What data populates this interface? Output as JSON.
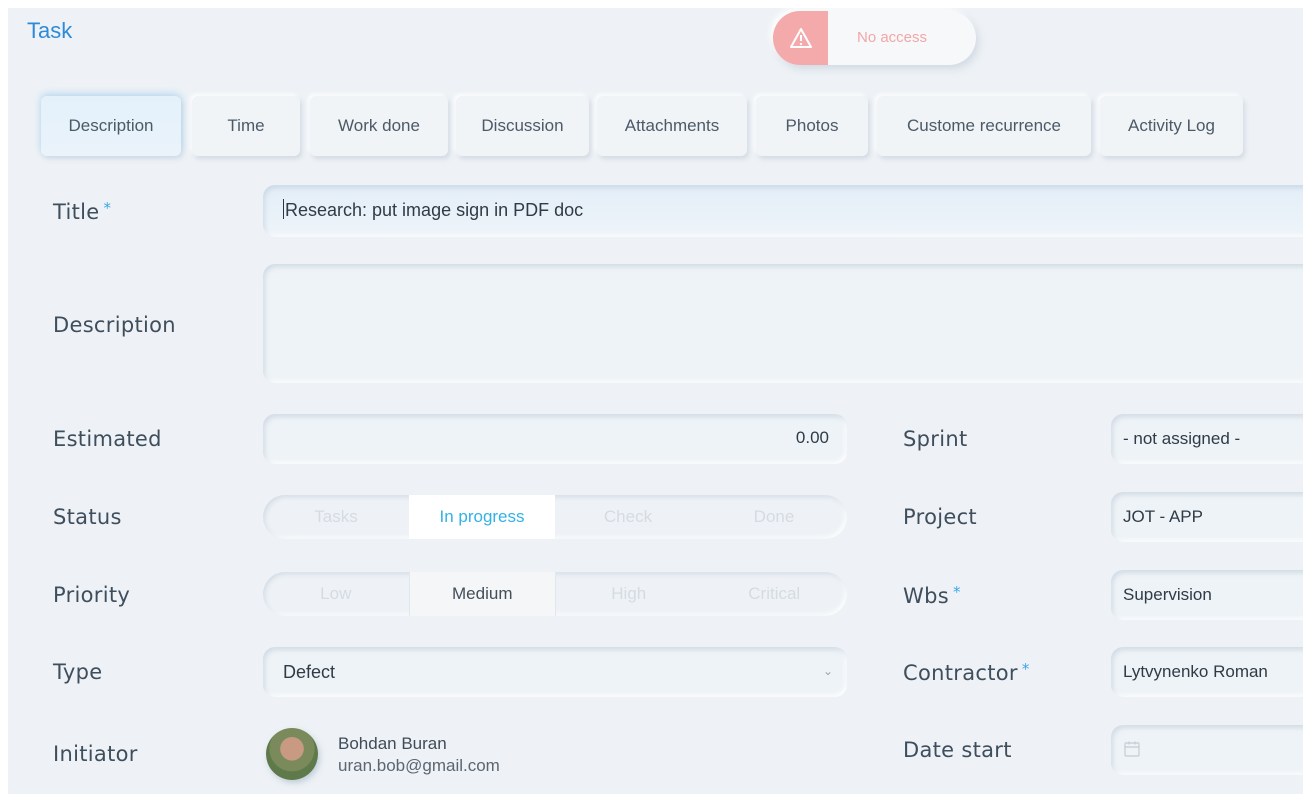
{
  "header": {
    "title": "Task"
  },
  "alert": {
    "text": "No access",
    "icon": "warning-icon"
  },
  "tabs": [
    {
      "label": "Description",
      "active": true
    },
    {
      "label": "Time"
    },
    {
      "label": "Work done"
    },
    {
      "label": "Discussion"
    },
    {
      "label": "Attachments"
    },
    {
      "label": "Photos"
    },
    {
      "label": "Custome recurrence"
    },
    {
      "label": "Activity Log"
    }
  ],
  "form": {
    "title": {
      "label": "Title",
      "required_mark": "*",
      "value": "Research: put image sign in PDF doc"
    },
    "description": {
      "label": "Description",
      "value": ""
    },
    "estimated": {
      "label": "Estimated",
      "value": "0.00"
    },
    "status": {
      "label": "Status",
      "options": [
        "Tasks",
        "In progress",
        "Check",
        "Done"
      ],
      "selected": "In progress"
    },
    "priority": {
      "label": "Priority",
      "options": [
        "Low",
        "Medium",
        "High",
        "Critical"
      ],
      "selected": "Medium"
    },
    "type": {
      "label": "Type",
      "value": "Defect"
    },
    "initiator": {
      "label": "Initiator",
      "name": "Bohdan Buran",
      "email": "uran.bob@gmail.com"
    },
    "sprint": {
      "label": "Sprint",
      "value": "- not assigned -"
    },
    "project": {
      "label": "Project",
      "value": "JOT - APP"
    },
    "wbs": {
      "label": "Wbs",
      "required_mark": "*",
      "value": "Supervision"
    },
    "contractor": {
      "label": "Contractor",
      "required_mark": "*",
      "value": "Lytvynenko Roman"
    },
    "date_start": {
      "label": "Date start",
      "value": ""
    }
  },
  "colors": {
    "accent": "#2e8ad8",
    "selected_text": "#33b1e6",
    "alert": "#f4aaaa"
  }
}
